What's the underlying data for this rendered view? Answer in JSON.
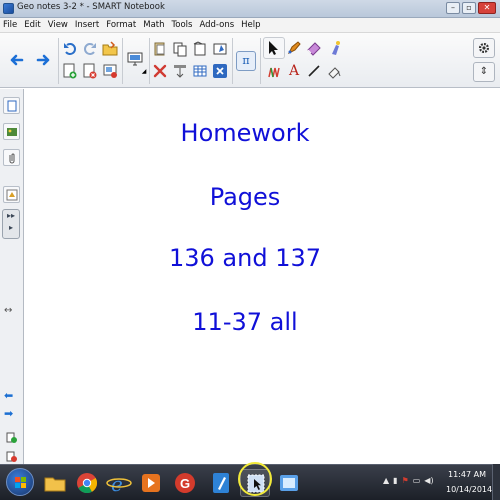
{
  "window": {
    "title": "Geo notes 3-2 * - SMART Notebook"
  },
  "menu": [
    "File",
    "Edit",
    "View",
    "Insert",
    "Format",
    "Math",
    "Tools",
    "Add-ons",
    "Help"
  ],
  "toolbar": {
    "math_symbol": "π",
    "settings_icon": "gear-icon",
    "move_icon": "move-arrows-icon"
  },
  "canvas": {
    "lines": [
      "Homework",
      "Pages",
      "136 and 137",
      "11-37 all"
    ],
    "text_color": "#1010d8"
  },
  "taskbar": {
    "time": "11:47 AM",
    "date": "10/14/2014"
  },
  "colors": {
    "accent": "#1c6fd6",
    "taskbar": "#1c2028",
    "highlight_ring": "#f2ea3a"
  }
}
